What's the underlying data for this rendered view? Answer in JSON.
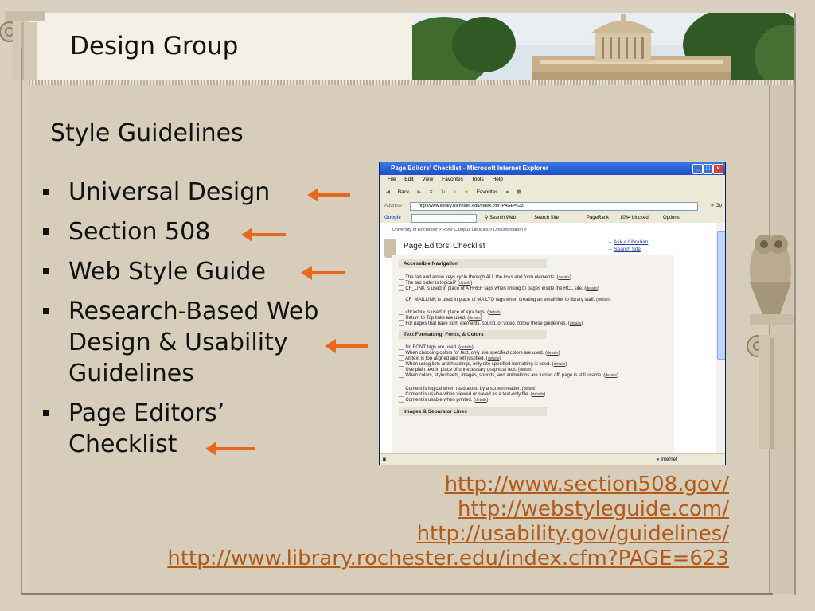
{
  "slide": {
    "title": "Design Group",
    "subtitle": "Style Guidelines",
    "bullets": [
      {
        "text": "Universal Design"
      },
      {
        "text": "Section 508"
      },
      {
        "text": "Web Style Guide"
      },
      {
        "text": "Research-Based Web Design & Usability Guidelines"
      },
      {
        "text": "Page Editors’ Checklist"
      }
    ],
    "links": [
      "http://www.section508.gov/",
      "http://webstyleguide.com/",
      "http://usability.gov/guidelines/",
      "http://www.library.rochester.edu/index.cfm?PAGE=623"
    ],
    "colors": {
      "arrow": "#e8691c",
      "link": "#b25a16",
      "background": "#d6cdbb"
    }
  },
  "browser": {
    "window_title": "Page Editors' Checklist - Microsoft Internet Explorer",
    "menu": [
      "File",
      "Edit",
      "View",
      "Favorites",
      "Tools",
      "Help"
    ],
    "toolbar": [
      "Back",
      "Favorites"
    ],
    "address_label": "Address",
    "address_value": "http://www.library.rochester.edu/index.cfm?PAGE=623",
    "go_label": "Go",
    "google_label": "Google",
    "google_tools": [
      "Search Web",
      "Search Site",
      "PageRank",
      "1084 blocked",
      "Options"
    ],
    "status_zone": "Internet",
    "page": {
      "breadcrumb": [
        "University of Rochester",
        ">",
        "River Campus Libraries",
        ">",
        "Documentation",
        ">"
      ],
      "title": "Page Editors' Checklist",
      "side_links": [
        "Ask a Librarian",
        "Search Site"
      ],
      "details_label": "details",
      "sections": [
        {
          "heading": "Accessible Navigation",
          "items": [
            "The tab and arrow keys cycle through ALL the links and form elements.",
            "The tab order is logical?",
            "CF_LINK is used in place of A HREF tags when linking to pages inside the RCL site.",
            "CF_MAILLINK is used in place of MAILTO tags when creating an email link to library staff.",
            "<br><br> is used in place of <p> tags.",
            "Return to Top links are used.",
            "For pages that have form elements, sound, or video, follow these guidelines."
          ]
        },
        {
          "heading": "Text Formatting, Fonts, & Colors",
          "items": [
            "No FONT tags are used.",
            "When choosing colors for text, only site specified colors are used.",
            "All text is top aligned and left justified.",
            "When using lists and headings, only site specified formatting is used.",
            "Use plain text in place of unnecessary graphical text.",
            "When colors, stylesheets, images, sounds, and animations are turned off, page is still usable.",
            "Content is logical when read aloud by a screen reader.",
            "Content is usable when viewed or saved as a text-only file.",
            "Content is usable when printed."
          ]
        },
        {
          "heading": "Images & Separator Lines",
          "items": []
        }
      ]
    }
  }
}
